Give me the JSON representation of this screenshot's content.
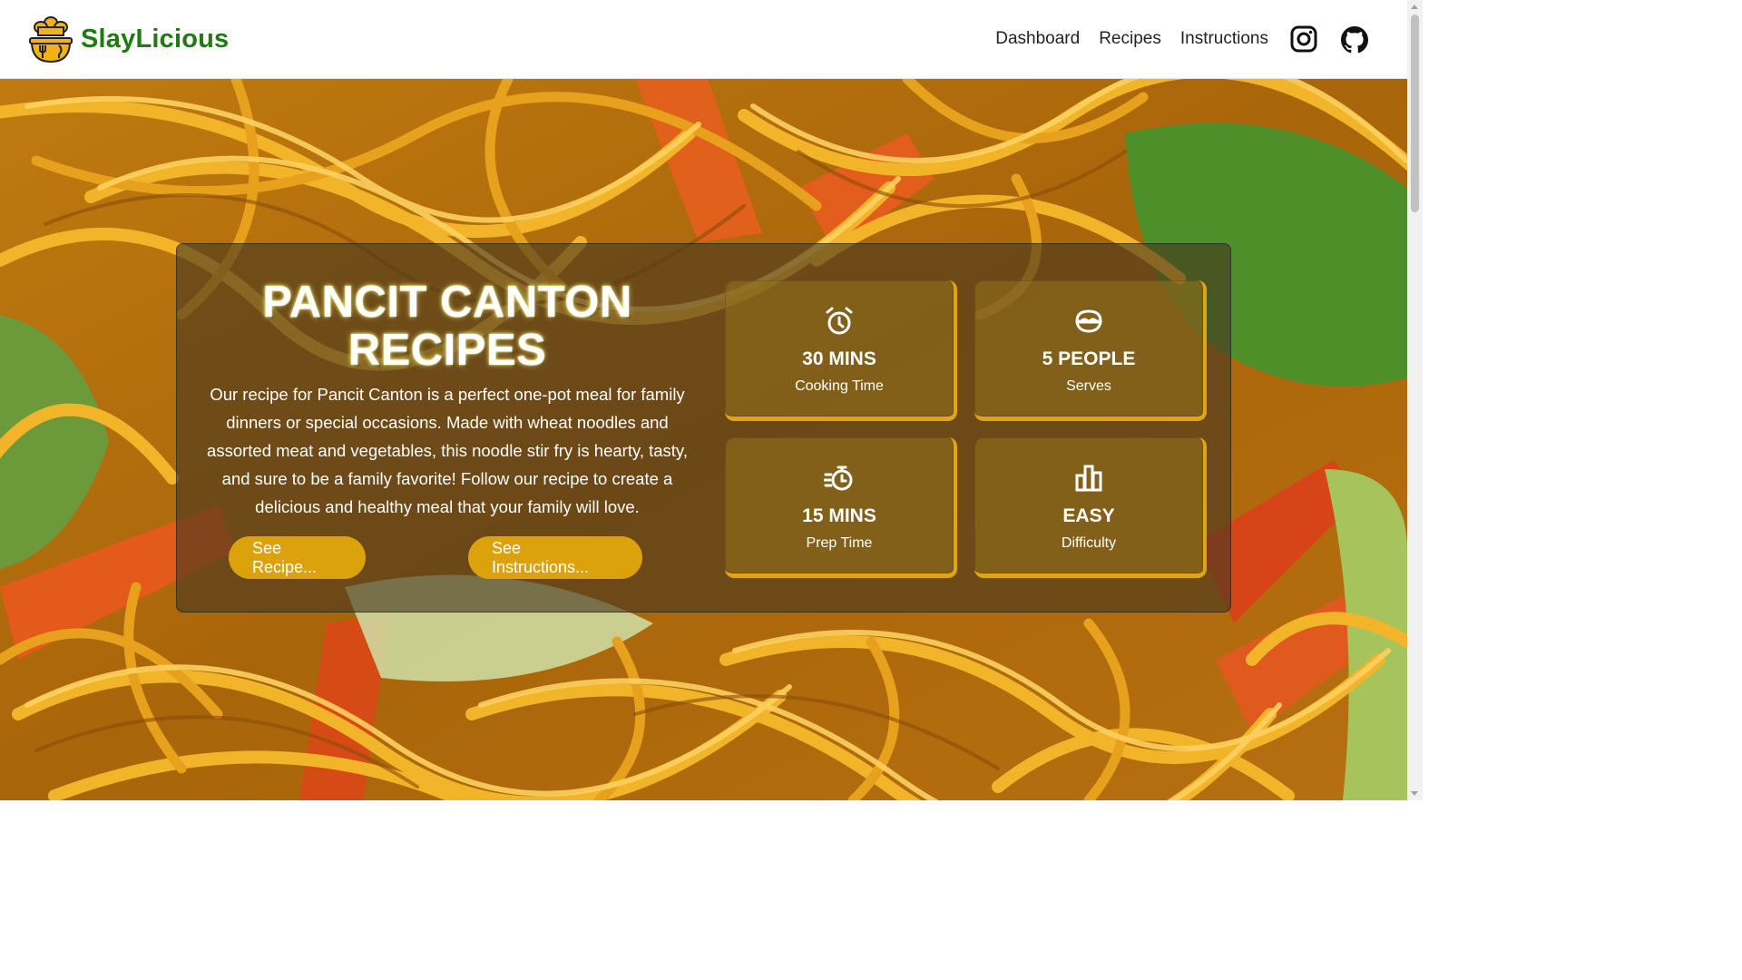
{
  "brand": {
    "name": "SlayLicious",
    "logo_icon": "chef-logo-icon",
    "color": "#1f7a12"
  },
  "nav": {
    "links": [
      "Dashboard",
      "Recipes",
      "Instructions"
    ],
    "icons": [
      "instagram-icon",
      "github-icon"
    ]
  },
  "hero": {
    "title_line1": "PANCIT CANTON",
    "title_line2": "RECIPES",
    "description": "Our recipe for Pancit Canton is a perfect one-pot meal for family dinners or special occasions. Made with wheat noodles and assorted meat and vegetables, this noodle stir fry is hearty, tasty, and sure to be a family favorite! Follow our recipe to create a delicious and healthy meal that your family will love.",
    "buttons": {
      "recipe": "See Recipe...",
      "instructions": "See Instructions..."
    },
    "accent": "#dba20b"
  },
  "stats": [
    {
      "value": "30 MINS",
      "label": "Cooking Time",
      "icon": "alarm-clock-icon"
    },
    {
      "value": "5 PEOPLE",
      "label": "Serves",
      "icon": "serving-bowl-icon"
    },
    {
      "value": "15 MINS",
      "label": "Prep Time",
      "icon": "stopwatch-icon"
    },
    {
      "value": "EASY",
      "label": "Difficulty",
      "icon": "bar-chart-icon"
    }
  ]
}
